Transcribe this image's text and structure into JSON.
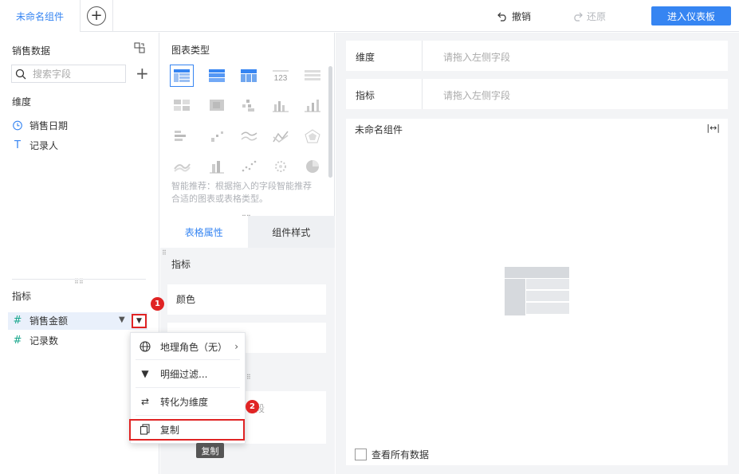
{
  "topbar": {
    "tab_label": "未命名组件",
    "undo_label": "撤销",
    "redo_label": "还原",
    "enter_dashboard_label": "进入仪表板"
  },
  "left_panel": {
    "title": "销售数据",
    "search_placeholder": "搜索字段",
    "dimensions_label": "维度",
    "dimensions": [
      {
        "label": "销售日期",
        "icon": "clock-icon"
      },
      {
        "label": "记录人",
        "icon": "text-type-icon"
      }
    ],
    "indicators_label": "指标",
    "indicators": [
      {
        "label": "销售金额",
        "icon": "hash-icon"
      },
      {
        "label": "记录数",
        "icon": "hash-icon"
      }
    ]
  },
  "middle_panel": {
    "chart_type_title": "图表类型",
    "table_icon_label": "123",
    "hint": "智能推荐：根据拖入的字段智能推荐合适的图表或表格类型。",
    "tabs": [
      "表格属性",
      "组件样式"
    ],
    "props_indicator_label": "指标",
    "color_label": "颜色",
    "partial_placeholder": "字段"
  },
  "right_panel": {
    "dimension_label": "维度",
    "indicator_label": "指标",
    "drop_placeholder": "请拖入左侧字段",
    "canvas_title": "未命名组件",
    "view_all_label": "查看所有数据"
  },
  "context_menu": {
    "items": [
      {
        "label": "地理角色（无）",
        "icon": "globe-icon"
      },
      {
        "label": "明细过滤...",
        "icon": "filter-icon"
      },
      {
        "label": "转化为维度",
        "icon": "swap-icon"
      },
      {
        "label": "复制",
        "icon": "copy-icon"
      }
    ],
    "tooltip": "复制"
  },
  "annotations": {
    "badge1": "1",
    "badge2": "2"
  },
  "colors": {
    "accent": "#3685f2",
    "highlight_red": "#e02424",
    "panel_bg": "#f3f4f6"
  }
}
